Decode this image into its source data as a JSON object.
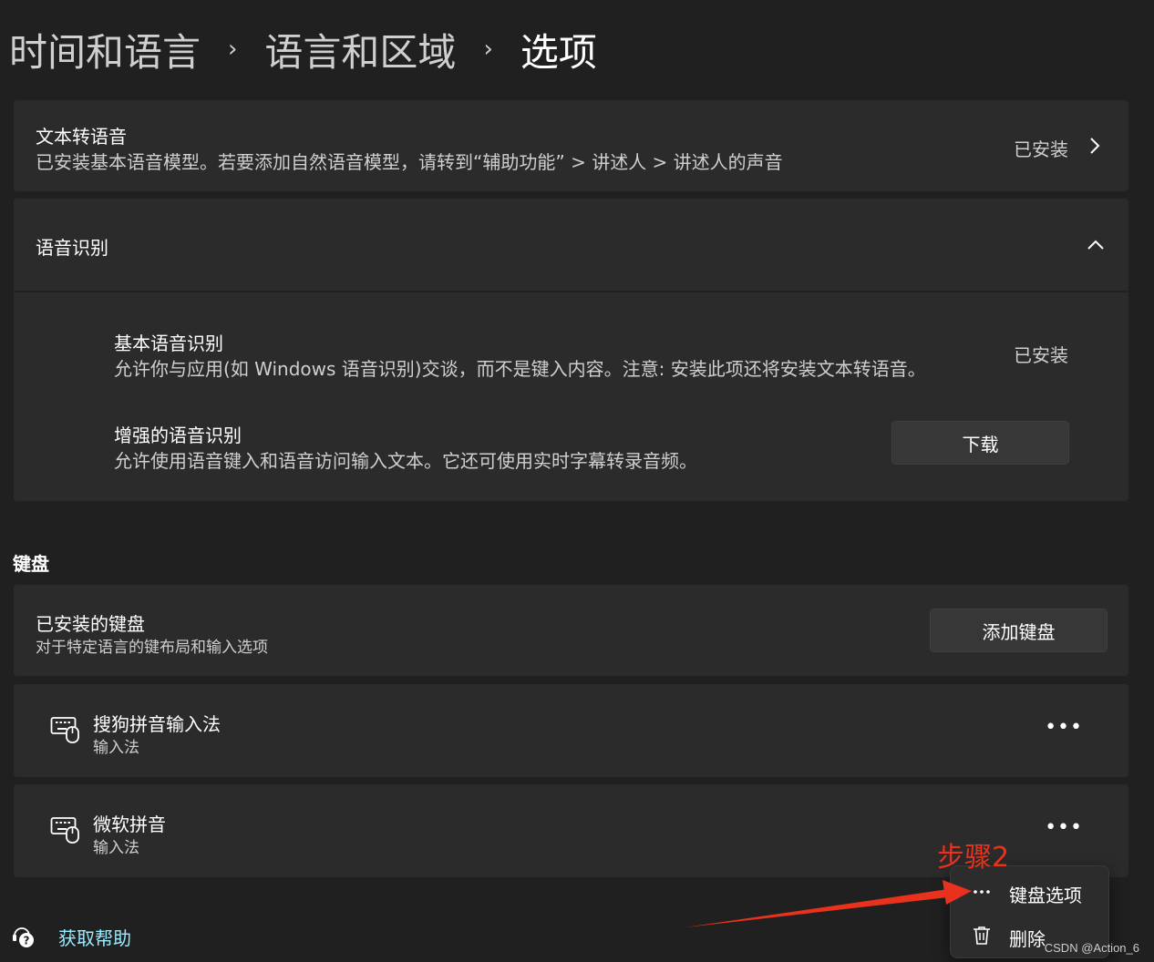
{
  "breadcrumb": {
    "items": [
      "时间和语言",
      "语言和区域",
      "选项"
    ],
    "separator": "›"
  },
  "tts": {
    "title": "文本转语音",
    "description": "已安装基本语音模型。若要添加自然语音模型，请转到“辅助功能” > 讲述人 > 讲述人的声音",
    "status": "已安装"
  },
  "speech_recognition": {
    "title": "语音识别",
    "basic": {
      "title": "基本语音识别",
      "description": "允许你与应用(如 Windows 语音识别)交谈，而不是键入内容。注意: 安装此项还将安装文本转语音。",
      "status": "已安装"
    },
    "enhanced": {
      "title": "增强的语音识别",
      "description": "允许使用语音键入和语音访问输入文本。它还可使用实时字幕转录音频。",
      "button": "下载"
    }
  },
  "keyboard": {
    "section_label": "键盘",
    "installed": {
      "title": "已安装的键盘",
      "subtitle": "对于特定语言的键布局和输入选项",
      "add_button": "添加键盘"
    },
    "items": [
      {
        "name": "搜狗拼音输入法",
        "type": "输入法"
      },
      {
        "name": "微软拼音",
        "type": "输入法"
      }
    ]
  },
  "context_menu": {
    "items": [
      {
        "label": "键盘选项",
        "icon": "more-dots-icon"
      },
      {
        "label": "删除",
        "icon": "trash-icon"
      }
    ]
  },
  "annotation": {
    "label": "步骤2",
    "color": "#e8321e"
  },
  "help": {
    "label": "获取帮助",
    "color": "#99ebff"
  },
  "watermark": "CSDN @Action_6"
}
